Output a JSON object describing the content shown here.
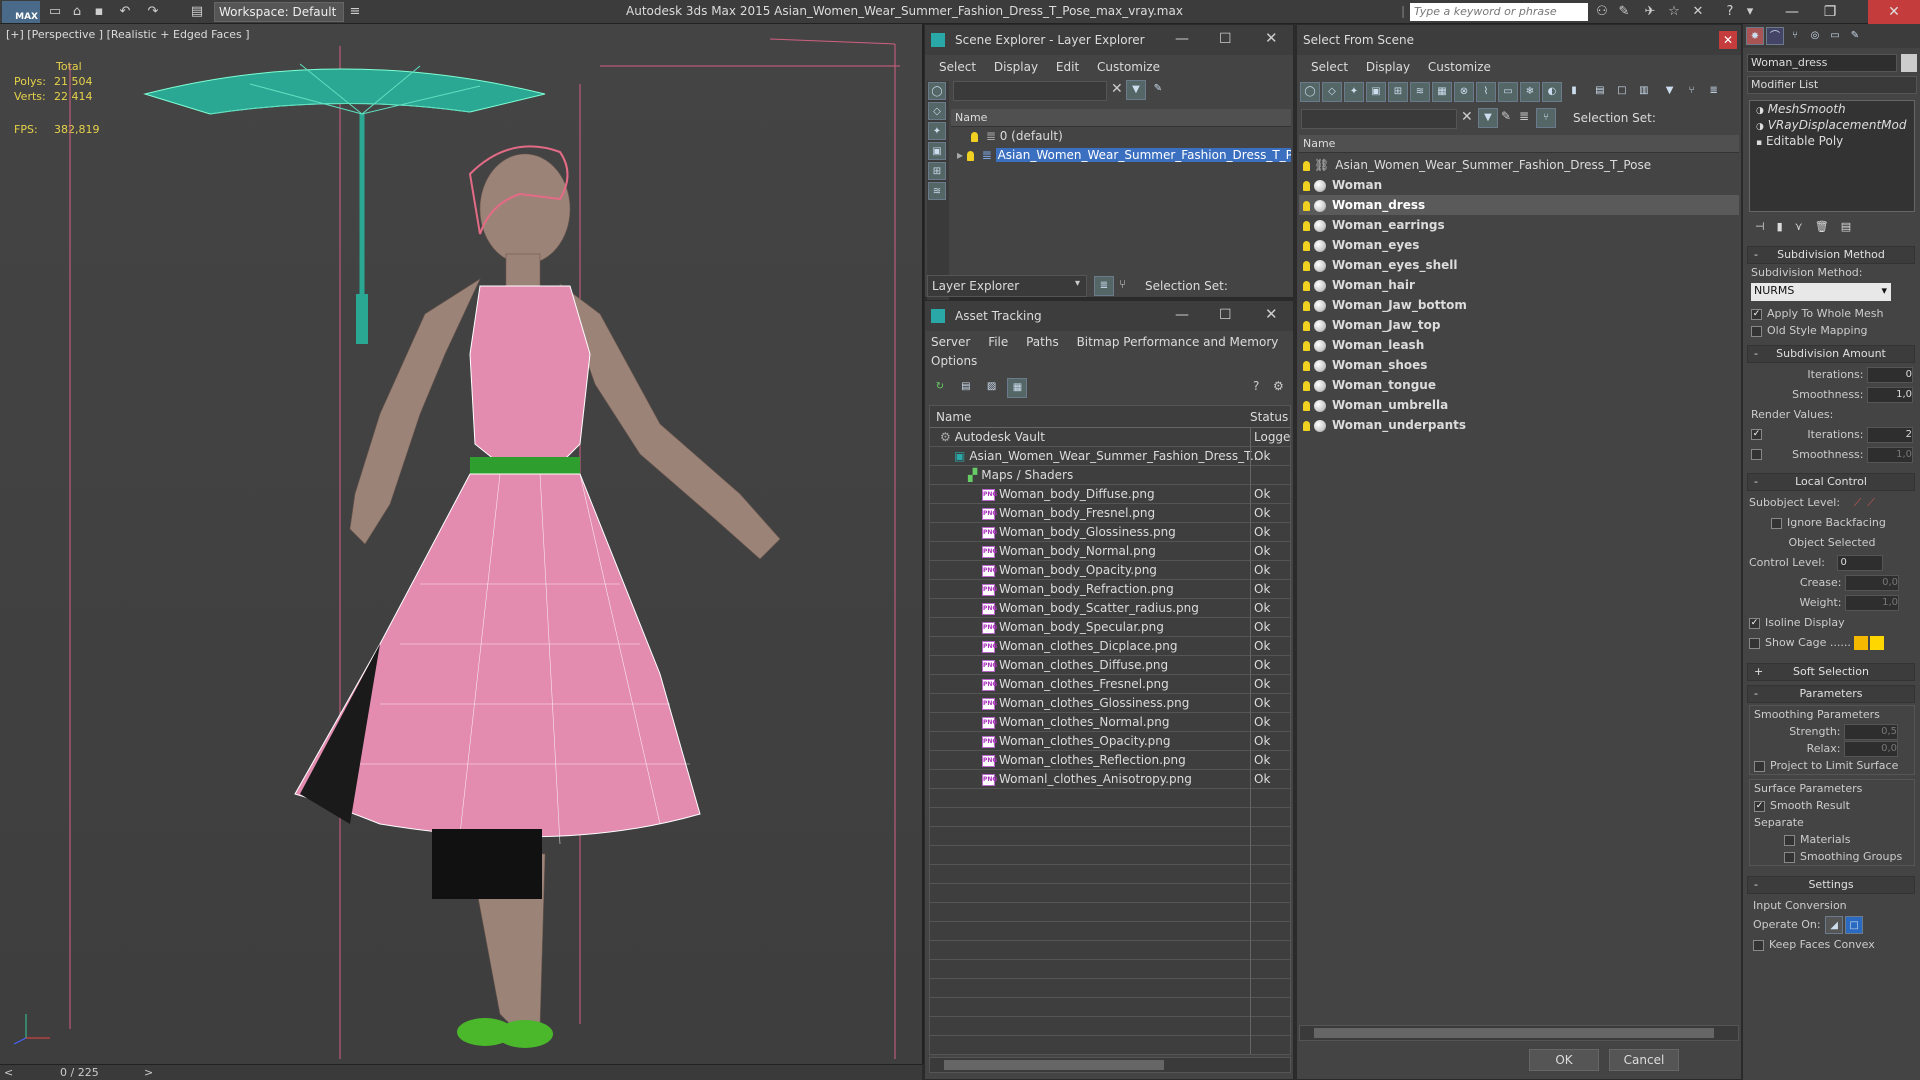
{
  "app": {
    "logo": "MAX",
    "workspace_label": "Workspace: Default",
    "title": "Autodesk 3ds Max  2015    Asian_Women_Wear_Summer_Fashion_Dress_T_Pose_max_vray.max",
    "search_placeholder": "Type a keyword or phrase"
  },
  "viewport": {
    "label": "[+] [Perspective ] [Realistic + Edged Faces ]",
    "stats": {
      "total_label": "Total",
      "polys_label": "Polys:",
      "polys_value": "21 504",
      "verts_label": "Verts:",
      "verts_value": "22 414",
      "fps_label": "FPS:",
      "fps_value": "382,819"
    },
    "timeline": "0 / 225",
    "prev": "<",
    "next": ">"
  },
  "scene_explorer": {
    "title": "Scene Explorer - Layer Explorer",
    "menu": [
      "Select",
      "Display",
      "Edit",
      "Customize"
    ],
    "column_name": "Name",
    "layers": [
      {
        "label": "0 (default)",
        "selected": false
      },
      {
        "label": "Asian_Women_Wear_Summer_Fashion_Dress_T_Pose",
        "selected": true
      }
    ],
    "footer_dropdown": "Layer Explorer",
    "selection_set_label": "Selection Set:"
  },
  "asset_tracking": {
    "title": "Asset Tracking",
    "menu_row1": [
      "Server",
      "File",
      "Paths",
      "Bitmap Performance and Memory"
    ],
    "menu_row2": [
      "Options"
    ],
    "col_name": "Name",
    "col_status": "Status",
    "rows": [
      {
        "name": "Autodesk Vault",
        "status": "Logged",
        "indent": 1,
        "icon": "vault"
      },
      {
        "name": "Asian_Women_Wear_Summer_Fashion_Dress_T...",
        "status": "Ok",
        "indent": 2,
        "icon": "max"
      },
      {
        "name": "Maps / Shaders",
        "status": "",
        "indent": 3,
        "icon": "maps"
      },
      {
        "name": "Woman_body_Diffuse.png",
        "status": "Ok",
        "indent": 4,
        "icon": "png"
      },
      {
        "name": "Woman_body_Fresnel.png",
        "status": "Ok",
        "indent": 4,
        "icon": "png"
      },
      {
        "name": "Woman_body_Glossiness.png",
        "status": "Ok",
        "indent": 4,
        "icon": "png"
      },
      {
        "name": "Woman_body_Normal.png",
        "status": "Ok",
        "indent": 4,
        "icon": "png"
      },
      {
        "name": "Woman_body_Opacity.png",
        "status": "Ok",
        "indent": 4,
        "icon": "png"
      },
      {
        "name": "Woman_body_Refraction.png",
        "status": "Ok",
        "indent": 4,
        "icon": "png"
      },
      {
        "name": "Woman_body_Scatter_radius.png",
        "status": "Ok",
        "indent": 4,
        "icon": "png"
      },
      {
        "name": "Woman_body_Specular.png",
        "status": "Ok",
        "indent": 4,
        "icon": "png"
      },
      {
        "name": "Woman_clothes_Dicplace.png",
        "status": "Ok",
        "indent": 4,
        "icon": "png"
      },
      {
        "name": "Woman_clothes_Diffuse.png",
        "status": "Ok",
        "indent": 4,
        "icon": "png"
      },
      {
        "name": "Woman_clothes_Fresnel.png",
        "status": "Ok",
        "indent": 4,
        "icon": "png"
      },
      {
        "name": "Woman_clothes_Glossiness.png",
        "status": "Ok",
        "indent": 4,
        "icon": "png"
      },
      {
        "name": "Woman_clothes_Normal.png",
        "status": "Ok",
        "indent": 4,
        "icon": "png"
      },
      {
        "name": "Woman_clothes_Opacity.png",
        "status": "Ok",
        "indent": 4,
        "icon": "png"
      },
      {
        "name": "Woman_clothes_Reflection.png",
        "status": "Ok",
        "indent": 4,
        "icon": "png"
      },
      {
        "name": "Womanl_clothes_Anisotropy.png",
        "status": "Ok",
        "indent": 4,
        "icon": "png"
      }
    ]
  },
  "select_from_scene": {
    "title": "Select From Scene",
    "menu": [
      "Select",
      "Display",
      "Customize"
    ],
    "selection_set_label": "Selection Set:",
    "column_name": "Name",
    "objects": [
      {
        "label": "Asian_Women_Wear_Summer_Fashion_Dress_T_Pose",
        "bold": false,
        "selected": false,
        "type": "group"
      },
      {
        "label": "Woman",
        "bold": true,
        "selected": false,
        "type": "mesh"
      },
      {
        "label": "Woman_dress",
        "bold": true,
        "selected": true,
        "type": "mesh"
      },
      {
        "label": "Woman_earrings",
        "bold": true,
        "selected": false,
        "type": "mesh"
      },
      {
        "label": "Woman_eyes",
        "bold": true,
        "selected": false,
        "type": "mesh"
      },
      {
        "label": "Woman_eyes_shell",
        "bold": true,
        "selected": false,
        "type": "mesh"
      },
      {
        "label": "Woman_hair",
        "bold": true,
        "selected": false,
        "type": "mesh"
      },
      {
        "label": "Woman_Jaw_bottom",
        "bold": true,
        "selected": false,
        "type": "mesh"
      },
      {
        "label": "Woman_Jaw_top",
        "bold": true,
        "selected": false,
        "type": "mesh"
      },
      {
        "label": "Woman_leash",
        "bold": true,
        "selected": false,
        "type": "mesh"
      },
      {
        "label": "Woman_shoes",
        "bold": true,
        "selected": false,
        "type": "mesh"
      },
      {
        "label": "Woman_tongue",
        "bold": true,
        "selected": false,
        "type": "mesh"
      },
      {
        "label": "Woman_umbrella",
        "bold": true,
        "selected": false,
        "type": "mesh"
      },
      {
        "label": "Woman_underpants",
        "bold": true,
        "selected": false,
        "type": "mesh"
      }
    ],
    "ok_label": "OK",
    "cancel_label": "Cancel"
  },
  "modify_panel": {
    "object_name": "Woman_dress",
    "modifier_list_label": "Modifier List",
    "stack": [
      "MeshSmooth",
      "VRayDisplacementMod",
      "Editable Poly"
    ],
    "subdivision_method": {
      "header": "Subdivision Method",
      "label": "Subdivision Method:",
      "value": "NURMS",
      "apply_whole_mesh": "Apply To Whole Mesh",
      "apply_whole_mesh_checked": true,
      "old_style": "Old Style Mapping",
      "old_style_checked": false
    },
    "subdivision_amount": {
      "header": "Subdivision Amount",
      "iterations_label": "Iterations:",
      "iterations": "0",
      "smoothness_label": "Smoothness:",
      "smoothness": "1,0",
      "render_values_label": "Render Values:",
      "render_iterations_label": "Iterations:",
      "render_iterations": "2",
      "render_iterations_checked": true,
      "render_smoothness_label": "Smoothness:",
      "render_smoothness": "1,0",
      "render_smoothness_checked": false
    },
    "local_control": {
      "header": "Local Control",
      "subobject_label": "Subobject Level:",
      "ignore_backfacing": "Ignore Backfacing",
      "object_selected": "Object Selected",
      "control_level_label": "Control Level:",
      "control_level": "0",
      "crease_label": "Crease:",
      "crease": "0,0",
      "weight_label": "Weight:",
      "weight": "1,0",
      "isoline_display": "Isoline Display",
      "isoline_checked": true,
      "show_cage": "Show Cage ......",
      "show_cage_checked": false,
      "cage_color1": "#f5b800",
      "cage_color2": "#ffd700"
    },
    "soft_selection_header": "Soft Selection",
    "parameters": {
      "header": "Parameters",
      "smoothing_group": "Smoothing Parameters",
      "strength_label": "Strength:",
      "strength": "0,5",
      "relax_label": "Relax:",
      "relax": "0,0",
      "project_limit": "Project to Limit Surface",
      "surface_group": "Surface Parameters",
      "smooth_result": "Smooth Result",
      "smooth_result_checked": true,
      "separate_label": "Separate",
      "materials": "Materials",
      "smoothing_groups": "Smoothing Groups"
    },
    "settings": {
      "header": "Settings",
      "input_conversion": "Input Conversion",
      "operate_on_label": "Operate On:",
      "keep_faces_convex": "Keep Faces Convex"
    }
  },
  "colors": {
    "selected_row": "#5a5a5a",
    "layer_selected": "#3b6fc0",
    "accent_yellow": "#e6d24a"
  }
}
